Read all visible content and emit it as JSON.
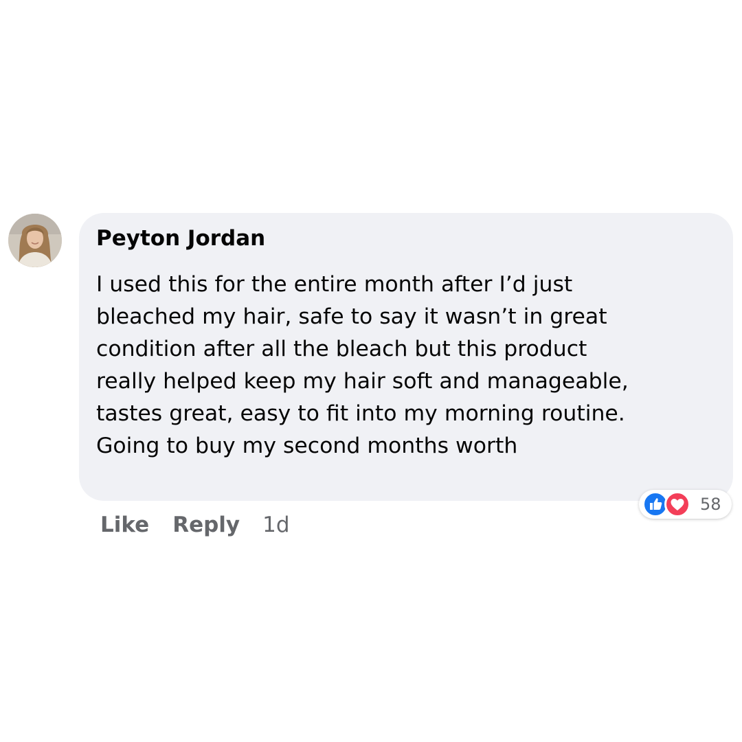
{
  "comment": {
    "author": "Peyton Jordan",
    "text_lines": [
      "I used this for the entire month after I’d just",
      "bleached my hair, safe to say it wasn’t in great",
      "condition after all the bleach but this product",
      "really helped keep my hair soft and manageable,",
      "tastes great, easy to fit into my morning routine.",
      "Going to buy my second months worth"
    ],
    "bubble_color": "#f0f1f5"
  },
  "reactions": {
    "icons": [
      "like-icon",
      "love-icon"
    ],
    "like_color": "#1877f2",
    "love_color": "#f33e58",
    "count": "58"
  },
  "actions": {
    "like_label": "Like",
    "reply_label": "Reply",
    "timestamp": "1d"
  }
}
